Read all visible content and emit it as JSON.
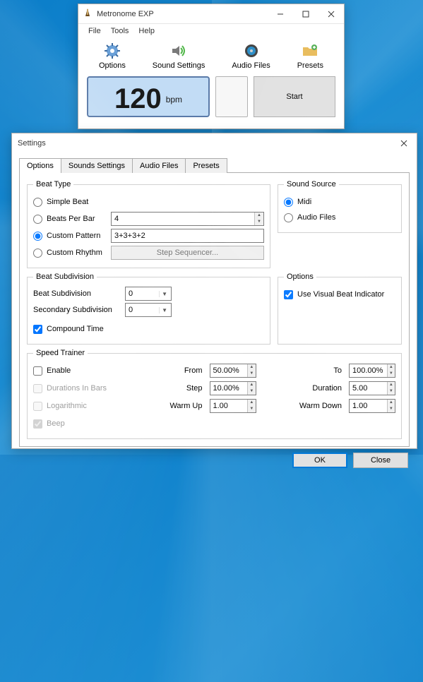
{
  "main": {
    "title": "Metronome EXP",
    "menu": {
      "file": "File",
      "tools": "Tools",
      "help": "Help"
    },
    "toolbar": {
      "options": "Options",
      "sound_settings": "Sound Settings",
      "audio_files": "Audio Files",
      "presets": "Presets"
    },
    "tempo": {
      "value": "120",
      "unit": "bpm"
    },
    "start": "Start"
  },
  "settings": {
    "title": "Settings",
    "tabs": {
      "options": "Options",
      "sounds": "Sounds Settings",
      "audio": "Audio Files",
      "presets": "Presets"
    },
    "beat_type": {
      "legend": "Beat Type",
      "simple": "Simple Beat",
      "bpb": "Beats Per Bar",
      "bpb_val": "4",
      "custom_pattern": "Custom Pattern",
      "pattern_val": "3+3+3+2",
      "custom_rhythm": "Custom Rhythm",
      "step_seq": "Step Sequencer..."
    },
    "sound_source": {
      "legend": "Sound Source",
      "midi": "Midi",
      "audio_files": "Audio Files"
    },
    "beat_sub": {
      "legend": "Beat Subdivision",
      "primary": "Beat Subdivision",
      "primary_val": "0",
      "secondary": "Secondary Subdivision",
      "secondary_val": "0",
      "compound": "Compound Time"
    },
    "options_box": {
      "legend": "Options",
      "visual": "Use Visual Beat Indicator"
    },
    "speed": {
      "legend": "Speed Trainer",
      "enable": "Enable",
      "durations": "Durations In Bars",
      "logarithmic": "Logarithmic",
      "beep": "Beep",
      "from": "From",
      "from_val": "50.00%",
      "step": "Step",
      "step_val": "10.00%",
      "warmup": "Warm Up",
      "warmup_val": "1.00",
      "to": "To",
      "to_val": "100.00%",
      "duration": "Duration",
      "duration_val": "5.00",
      "warmdown": "Warm Down",
      "warmdown_val": "1.00"
    },
    "buttons": {
      "ok": "OK",
      "close": "Close"
    }
  }
}
